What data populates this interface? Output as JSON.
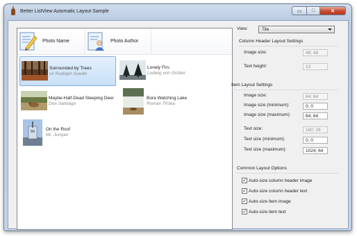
{
  "window": {
    "title": "Better ListView Automatic Layout Sample",
    "controls": {
      "minimize": "▭",
      "maximize": "□",
      "close": "✕"
    }
  },
  "listview": {
    "columns": [
      {
        "label": "Photo Name",
        "icon": "pencil-document-icon"
      },
      {
        "label": "Photo Author",
        "icon": "user-document-icon"
      }
    ],
    "items": [
      {
        "name": "Sorrounded by Trees",
        "author": "sir Rudolph Sueille",
        "selected": true,
        "thumb": "forest-photo"
      },
      {
        "name": "Lonely Firs",
        "author": "Ludwig von Grüber",
        "selected": false,
        "thumb": "firs-photo"
      },
      {
        "name": "Maybe-Half-Dead Sleeping Deer",
        "author": "Don Santiago",
        "selected": false,
        "thumb": "deer-photo"
      },
      {
        "name": "Bora Watching Lake",
        "author": "Roman Tříska",
        "selected": false,
        "thumb": "lake-photo"
      },
      {
        "name": "On the Roof",
        "author": "Mr. Jumper",
        "selected": false,
        "thumb": "roof-photo"
      }
    ]
  },
  "settings": {
    "view_label": "View:",
    "view_value": "Tile",
    "column_header": {
      "title": "Column Header Layout Settings",
      "image_size_label": "Image size:",
      "image_size_value": "48; 48",
      "text_height_label": "Text height:",
      "text_height_value": "13"
    },
    "item_layout": {
      "title": "Item Layout Settings",
      "image_size_label": "Image size:",
      "image_size_value": "64; 64",
      "image_min_label": "Image size (minimum):",
      "image_min_value": "0; 0",
      "image_max_label": "Image size (maximum):",
      "image_max_value": "64; 64",
      "text_size_label": "Text size:",
      "text_size_value": "160; 26",
      "text_min_label": "Text size (minimum):",
      "text_min_value": "0; 0",
      "text_max_label": "Text size (maximum):",
      "text_max_value": "1024; 64"
    },
    "common": {
      "title": "Common Layout Options",
      "check_mark": "✓",
      "options": [
        {
          "label": "Auto-size column header image",
          "checked": true
        },
        {
          "label": "Auto-size column header text",
          "checked": true
        },
        {
          "label": "Auto-size item image",
          "checked": true
        },
        {
          "label": "Auto-size item text",
          "checked": true
        }
      ]
    }
  }
}
